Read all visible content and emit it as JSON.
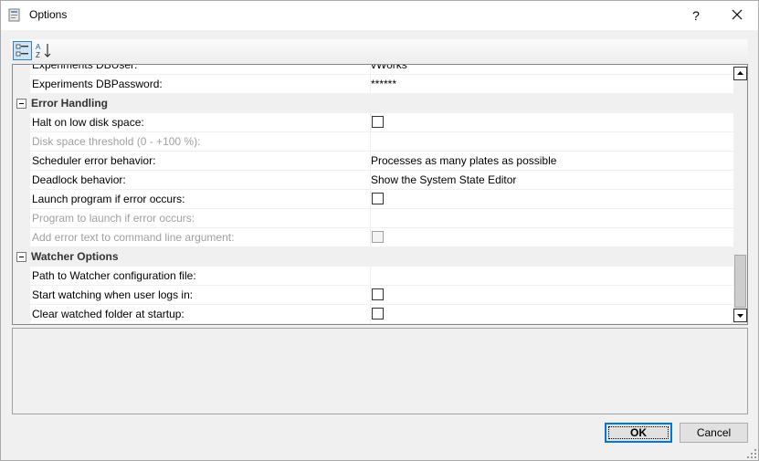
{
  "window": {
    "title": "Options",
    "help_glyph": "?"
  },
  "toolbar": {
    "categorized_icon": "categorized-icon",
    "alphabetical_icon": "alphabetical-sort-icon"
  },
  "grid": {
    "rows": [
      {
        "type": "prop",
        "name": "Experiments DBUser:",
        "value": "vWorks",
        "disabled": false
      },
      {
        "type": "prop",
        "name": "Experiments DBPassword:",
        "value": "******",
        "disabled": false
      },
      {
        "type": "category",
        "name": "Error Handling",
        "expanded": true
      },
      {
        "type": "prop",
        "name": "Halt on low disk space:",
        "checkbox": true,
        "checked": false,
        "disabled": false
      },
      {
        "type": "prop",
        "name": "Disk space threshold (0 - +100 %):",
        "value": "",
        "disabled": true
      },
      {
        "type": "prop",
        "name": "Scheduler error behavior:",
        "value": "Processes as many plates as possible",
        "disabled": false
      },
      {
        "type": "prop",
        "name": "Deadlock behavior:",
        "value": "Show the System State Editor",
        "disabled": false
      },
      {
        "type": "prop",
        "name": "Launch program if error occurs:",
        "checkbox": true,
        "checked": false,
        "disabled": false
      },
      {
        "type": "prop",
        "name": "Program to launch if error occurs:",
        "value": "",
        "disabled": true
      },
      {
        "type": "prop",
        "name": "Add error text to command line argument:",
        "checkbox": true,
        "checked": false,
        "disabled": true
      },
      {
        "type": "category",
        "name": "Watcher Options",
        "expanded": true
      },
      {
        "type": "prop",
        "name": "Path to Watcher configuration file:",
        "value": "",
        "disabled": false
      },
      {
        "type": "prop",
        "name": "Start watching when user logs in:",
        "checkbox": true,
        "checked": false,
        "disabled": false
      },
      {
        "type": "prop",
        "name": "Clear watched folder at startup:",
        "checkbox": true,
        "checked": false,
        "disabled": false
      }
    ]
  },
  "buttons": {
    "ok_label": "OK",
    "cancel_label": "Cancel"
  },
  "colors": {
    "accent": "#0078d7",
    "category_bg": "#f0f0f0",
    "disabled_text": "#a0a0a0"
  }
}
